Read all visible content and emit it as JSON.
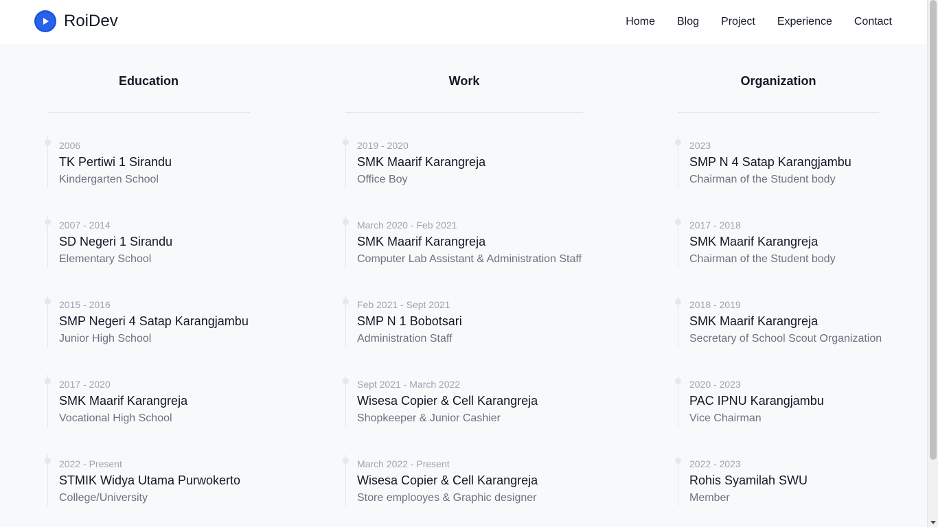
{
  "brand": {
    "name": "RoiDev",
    "logo_icon": "play-icon",
    "logo_color": "#2563eb"
  },
  "nav": [
    {
      "label": "Home"
    },
    {
      "label": "Blog"
    },
    {
      "label": "Project"
    },
    {
      "label": "Experience"
    },
    {
      "label": "Contact"
    }
  ],
  "columns": [
    {
      "title": "Education",
      "entries": [
        {
          "date": "2006",
          "place": "TK Pertiwi 1 Sirandu",
          "role": "Kindergarten School"
        },
        {
          "date": "2007 - 2014",
          "place": "SD Negeri 1 Sirandu",
          "role": "Elementary School"
        },
        {
          "date": "2015 - 2016",
          "place": "SMP Negeri 4 Satap Karangjambu",
          "role": "Junior High School"
        },
        {
          "date": "2017 - 2020",
          "place": "SMK Maarif Karangreja",
          "role": "Vocational High School"
        },
        {
          "date": "2022 - Present",
          "place": "STMIK Widya Utama Purwokerto",
          "role": "College/University"
        }
      ]
    },
    {
      "title": "Work",
      "entries": [
        {
          "date": "2019 - 2020",
          "place": "SMK Maarif Karangreja",
          "role": "Office Boy"
        },
        {
          "date": "March 2020 - Feb 2021",
          "place": "SMK Maarif Karangreja",
          "role": "Computer Lab Assistant & Administration Staff"
        },
        {
          "date": "Feb 2021 - Sept 2021",
          "place": "SMP N 1 Bobotsari",
          "role": "Administration Staff"
        },
        {
          "date": "Sept 2021 - March 2022",
          "place": "Wisesa Copier & Cell Karangreja",
          "role": "Shopkeeper & Junior Cashier"
        },
        {
          "date": "March 2022 - Present",
          "place": "Wisesa Copier & Cell Karangreja",
          "role": "Store emplooyes & Graphic designer"
        }
      ]
    },
    {
      "title": "Organization",
      "entries": [
        {
          "date": "2023",
          "place": "SMP N 4 Satap Karangjambu",
          "role": "Chairman of the Student body"
        },
        {
          "date": "2017 - 2018",
          "place": "SMK Maarif Karangreja",
          "role": "Chairman of the Student body"
        },
        {
          "date": "2018 - 2019",
          "place": "SMK Maarif Karangreja",
          "role": "Secretary of School Scout Organization"
        },
        {
          "date": "2020 - 2023",
          "place": "PAC IPNU Karangjambu",
          "role": "Vice Chairman"
        },
        {
          "date": "2022 - 2023",
          "place": "Rohis Syamilah SWU",
          "role": "Member"
        }
      ]
    }
  ]
}
